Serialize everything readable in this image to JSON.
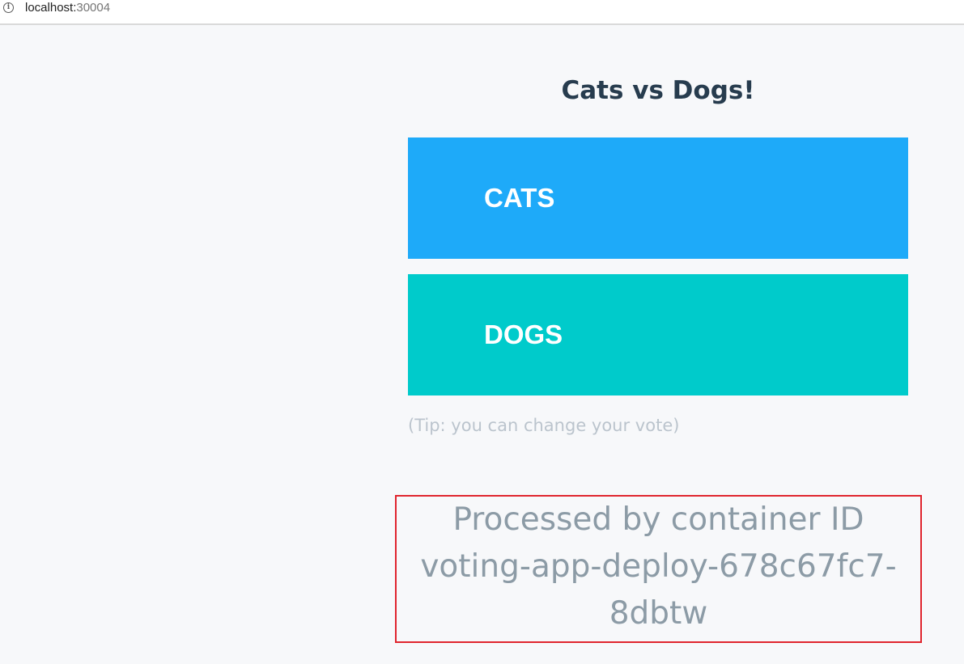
{
  "browser": {
    "url_host": "localhost:",
    "url_port": "30004",
    "info_icon": "info-icon"
  },
  "page": {
    "title": "Cats vs Dogs!",
    "options": [
      {
        "label": "CATS",
        "color": "#1eaaf9"
      },
      {
        "label": "DOGS",
        "color": "#00cbcb"
      }
    ],
    "tip": "(Tip: you can change your vote)",
    "container_line1": "Processed by container ID",
    "container_line2": "voting-app-deploy-678c67fc7-",
    "container_line3": "8dbtw"
  },
  "colors": {
    "background": "#f7f8fa",
    "title": "#273c4e",
    "tip": "#bbc4cd",
    "container_text": "#8c9ba6",
    "highlight_border": "#e0252e"
  }
}
